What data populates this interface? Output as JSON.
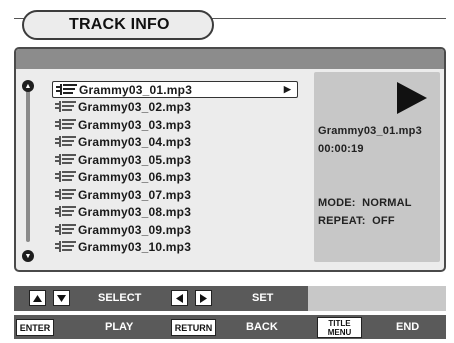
{
  "header": {
    "title": "TRACK INFO"
  },
  "tracks": [
    {
      "name": "Grammy03_01.mp3",
      "selected": true
    },
    {
      "name": "Grammy03_02.mp3"
    },
    {
      "name": "Grammy03_03.mp3"
    },
    {
      "name": "Grammy03_04.mp3"
    },
    {
      "name": "Grammy03_05.mp3"
    },
    {
      "name": "Grammy03_06.mp3"
    },
    {
      "name": "Grammy03_07.mp3"
    },
    {
      "name": "Grammy03_08.mp3"
    },
    {
      "name": "Grammy03_09.mp3"
    },
    {
      "name": "Grammy03_10.mp3"
    }
  ],
  "info": {
    "status_icon": "play-icon",
    "filename": "Grammy03_01.mp3",
    "time": "00:00:19",
    "mode": "MODE:  NORMAL",
    "repeat": "REPEAT:  OFF"
  },
  "keys": {
    "select": "SELECT",
    "set": "SET",
    "enter": "ENTER",
    "play": "PLAY",
    "return": "RETURN",
    "back": "BACK",
    "title_menu_top": "TITLE",
    "title_menu_bottom": "MENU",
    "end": "END"
  },
  "colors": {
    "panel": "#ececec",
    "strip": "#8c8c8c",
    "info_bg": "#c7c7c7",
    "key_bar": "#c8c8c8"
  }
}
